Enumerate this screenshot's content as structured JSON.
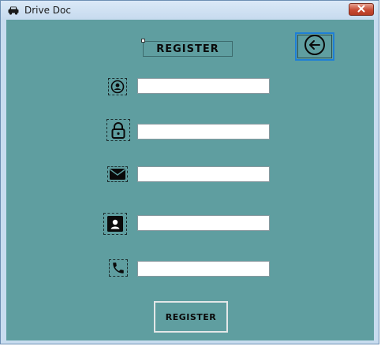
{
  "window": {
    "title": "Drive Doc",
    "icons": {
      "app": "car-icon",
      "close": "close-icon"
    }
  },
  "form": {
    "heading": "REGISTER",
    "back_icon": "back-arrow-icon",
    "fields": [
      {
        "icon": "user-circle-icon",
        "value": ""
      },
      {
        "icon": "lock-icon",
        "value": ""
      },
      {
        "icon": "envelope-icon",
        "value": ""
      },
      {
        "icon": "contact-card-icon",
        "value": ""
      },
      {
        "icon": "phone-icon",
        "value": ""
      }
    ],
    "submit_label": "REGISTER"
  },
  "colors": {
    "background": "#5f9ea0",
    "accent": "#1f7fd6",
    "close": "#c74a33"
  }
}
